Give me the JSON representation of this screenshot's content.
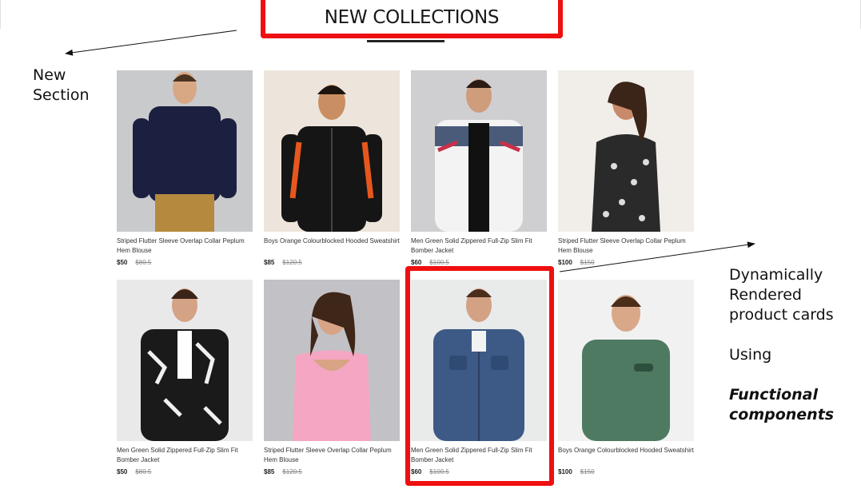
{
  "header": {
    "title": "NEW COLLECTIONS"
  },
  "annotations": {
    "left": [
      "New",
      "Section"
    ],
    "right": [
      "Dynamically",
      "Rendered",
      "product cards",
      "Using",
      "Functional",
      "components"
    ]
  },
  "products": [
    {
      "name": "Striped Flutter Sleeve Overlap Collar Peplum Hem Blouse",
      "new_price": "$50",
      "old_price": "$80.5"
    },
    {
      "name": "Boys Orange Colourblocked Hooded Sweatshirt",
      "new_price": "$85",
      "old_price": "$120.5"
    },
    {
      "name": "Men Green Solid Zippered Full-Zip Slim Fit Bomber Jacket",
      "new_price": "$60",
      "old_price": "$100.5"
    },
    {
      "name": "Striped Flutter Sleeve Overlap Collar Peplum Hem Blouse",
      "new_price": "$100",
      "old_price": "$150"
    },
    {
      "name": "Men Green Solid Zippered Full-Zip Slim Fit Bomber Jacket",
      "new_price": "$50",
      "old_price": "$80.5"
    },
    {
      "name": "Striped Flutter Sleeve Overlap Collar Peplum Hem Blouse",
      "new_price": "$85",
      "old_price": "$120.5"
    },
    {
      "name": "Men Green Solid Zippered Full-Zip Slim Fit Bomber Jacket",
      "new_price": "$60",
      "old_price": "$100.5"
    },
    {
      "name": "Boys Orange Colourblocked Hooded Sweatshirt",
      "new_price": "$100",
      "old_price": "$150"
    }
  ],
  "colors": {
    "highlight": "#ee1010",
    "title_text": "#171717"
  }
}
